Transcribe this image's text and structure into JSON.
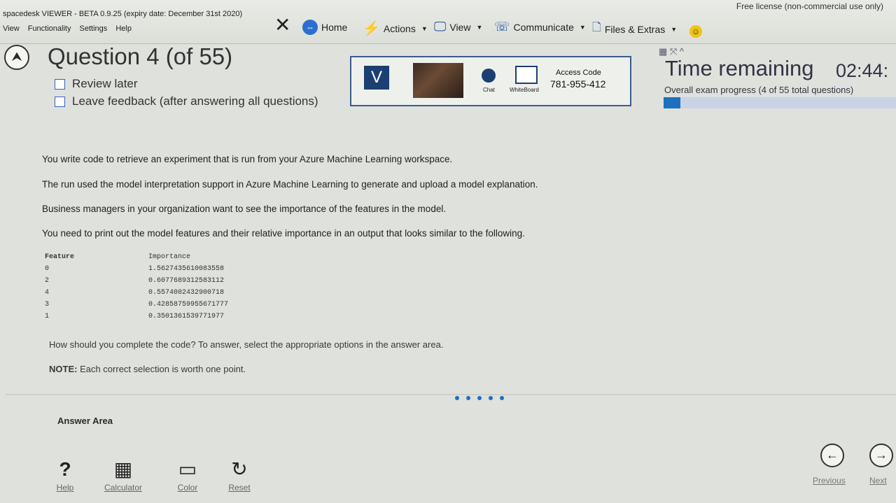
{
  "app": {
    "title": "spacedesk VIEWER - BETA 0.9.25 (expiry date: December 31st 2020)",
    "menu": [
      "View",
      "Functionality",
      "Settings",
      "Help"
    ],
    "license": "Free license (non-commercial use only)"
  },
  "remote_toolbar": {
    "home": "Home",
    "actions": "Actions",
    "view": "View",
    "communicate": "Communicate",
    "files": "Files & Extras"
  },
  "exam": {
    "question_title": "Question 4 (of 55)",
    "review_later": "Review later",
    "leave_feedback": "Leave feedback (after answering all questions)",
    "proctor": {
      "logo": "V",
      "chat_label": "Chat",
      "whiteboard_label": "WhiteBoard",
      "access_code_label": "Access Code",
      "access_code": "781-955-412"
    },
    "time_label": "Time remaining",
    "time_value": "02:44:",
    "progress_label": "Overall exam progress (4 of 55 total questions)",
    "progress_fraction": 0.0727
  },
  "question": {
    "paragraphs": [
      "You write code to retrieve an experiment that is run from your Azure Machine Learning workspace.",
      "The run used the model interpretation support in Azure Machine Learning to generate and upload a model explanation.",
      "Business managers in your organization want to see the importance of the features in the model.",
      "You need to print out the model features and their relative importance in an output that looks similar to the following."
    ],
    "table": {
      "headers": [
        "Feature",
        "Importance"
      ],
      "rows": [
        [
          "0",
          "1.5627435610083558"
        ],
        [
          "2",
          "0.6077689312583112"
        ],
        [
          "4",
          "0.5574002432900718"
        ],
        [
          "3",
          "0.42858759955671777"
        ],
        [
          "1",
          "0.3501361539771977"
        ]
      ]
    },
    "instruction": "How should you complete the code? To answer, select the appropriate options in the answer area.",
    "note_prefix": "NOTE:",
    "note": " Each correct selection is worth one point.",
    "answer_area": "Answer Area"
  },
  "footer": {
    "help": "Help",
    "calculator": "Calculator",
    "color": "Color",
    "reset": "Reset",
    "previous": "Previous",
    "next": "Next"
  },
  "colors": {
    "accent": "#1e6fc0",
    "proctor_border": "#3c5b8f"
  }
}
